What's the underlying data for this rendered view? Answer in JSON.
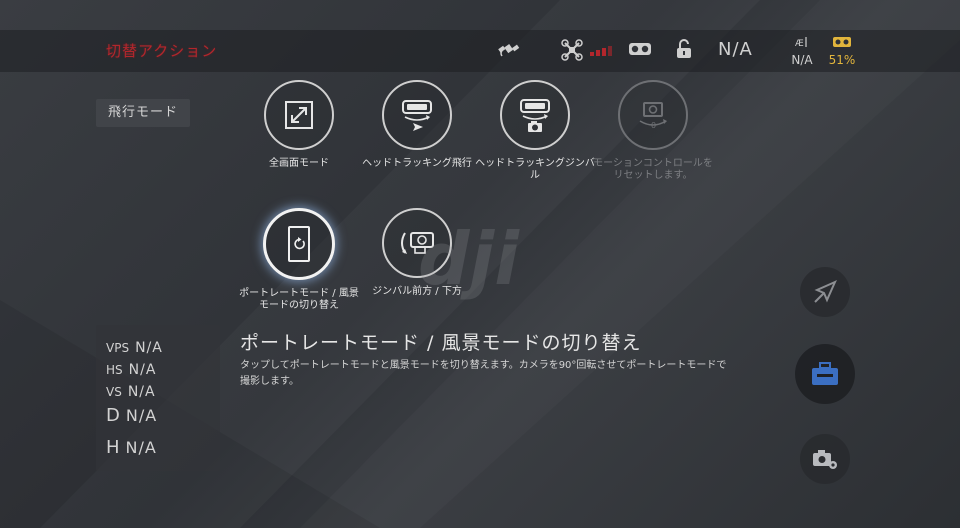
{
  "topbar": {
    "title": "切替アクション",
    "center_status": "N/A",
    "altitude_value": "N/A",
    "battery_value": "51%"
  },
  "flight_mode": {
    "label": "飛行モード"
  },
  "functions": [
    {
      "id": "fullscreen",
      "label": "全画面モード",
      "icon": "fullscreen-icon",
      "enabled": true,
      "selected": false
    },
    {
      "id": "head-tracking-flight",
      "label": "ヘッドトラッキング飛行",
      "icon": "head-tracking-flight-icon",
      "enabled": true,
      "selected": false
    },
    {
      "id": "head-tracking-gimbal",
      "label": "ヘッドトラッキングジンバル",
      "icon": "head-tracking-gimbal-icon",
      "enabled": true,
      "selected": false
    },
    {
      "id": "motion-reset",
      "label": "モーションコントロールをリセットします。",
      "icon": "motion-reset-icon",
      "enabled": false,
      "selected": false
    },
    {
      "id": "portrait-landscape",
      "label": "ポートレートモード / 風景モードの切り替え",
      "icon": "portrait-rotate-icon",
      "enabled": true,
      "selected": true
    },
    {
      "id": "gimbal-forward-down",
      "label": "ジンバル前方 / 下方",
      "icon": "gimbal-forward-down-icon",
      "enabled": true,
      "selected": false
    }
  ],
  "telemetry": [
    {
      "key": "VPS",
      "value": "N/A"
    },
    {
      "key": "HS",
      "value": "N/A"
    },
    {
      "key": "VS",
      "value": "N/A"
    },
    {
      "key": "D",
      "value": "N/A"
    },
    {
      "key": "H",
      "value": "N/A"
    }
  ],
  "description": {
    "title": "ポートレートモード / 風景モードの切り替え",
    "body": "タップしてポートレートモードと風景モードを切り替えます。カメラを90°回転させてポートレートモードで撮影します。"
  },
  "colors": {
    "accent_red": "#b3262c",
    "battery": "#e2b53c",
    "tool_blue": "#3b6fc2"
  }
}
